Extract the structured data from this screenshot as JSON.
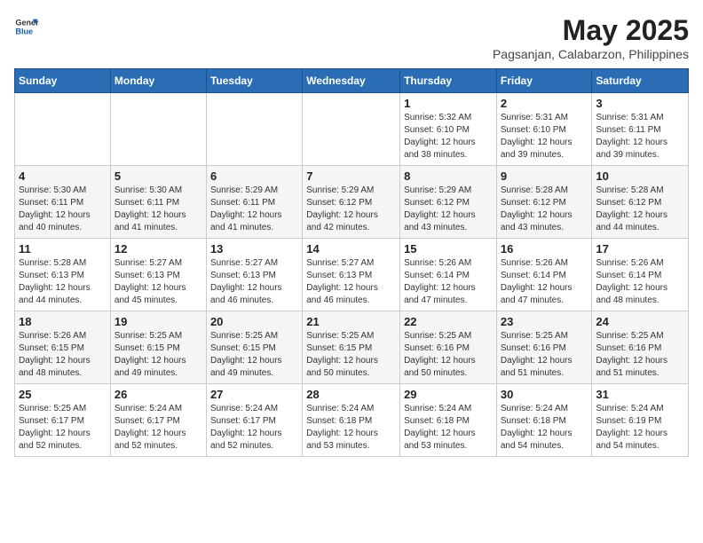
{
  "logo": {
    "general": "General",
    "blue": "Blue"
  },
  "title": "May 2025",
  "subtitle": "Pagsanjan, Calabarzon, Philippines",
  "headers": [
    "Sunday",
    "Monday",
    "Tuesday",
    "Wednesday",
    "Thursday",
    "Friday",
    "Saturday"
  ],
  "weeks": [
    [
      {
        "day": "",
        "info": ""
      },
      {
        "day": "",
        "info": ""
      },
      {
        "day": "",
        "info": ""
      },
      {
        "day": "",
        "info": ""
      },
      {
        "day": "1",
        "info": "Sunrise: 5:32 AM\nSunset: 6:10 PM\nDaylight: 12 hours\nand 38 minutes."
      },
      {
        "day": "2",
        "info": "Sunrise: 5:31 AM\nSunset: 6:10 PM\nDaylight: 12 hours\nand 39 minutes."
      },
      {
        "day": "3",
        "info": "Sunrise: 5:31 AM\nSunset: 6:11 PM\nDaylight: 12 hours\nand 39 minutes."
      }
    ],
    [
      {
        "day": "4",
        "info": "Sunrise: 5:30 AM\nSunset: 6:11 PM\nDaylight: 12 hours\nand 40 minutes."
      },
      {
        "day": "5",
        "info": "Sunrise: 5:30 AM\nSunset: 6:11 PM\nDaylight: 12 hours\nand 41 minutes."
      },
      {
        "day": "6",
        "info": "Sunrise: 5:29 AM\nSunset: 6:11 PM\nDaylight: 12 hours\nand 41 minutes."
      },
      {
        "day": "7",
        "info": "Sunrise: 5:29 AM\nSunset: 6:12 PM\nDaylight: 12 hours\nand 42 minutes."
      },
      {
        "day": "8",
        "info": "Sunrise: 5:29 AM\nSunset: 6:12 PM\nDaylight: 12 hours\nand 43 minutes."
      },
      {
        "day": "9",
        "info": "Sunrise: 5:28 AM\nSunset: 6:12 PM\nDaylight: 12 hours\nand 43 minutes."
      },
      {
        "day": "10",
        "info": "Sunrise: 5:28 AM\nSunset: 6:12 PM\nDaylight: 12 hours\nand 44 minutes."
      }
    ],
    [
      {
        "day": "11",
        "info": "Sunrise: 5:28 AM\nSunset: 6:13 PM\nDaylight: 12 hours\nand 44 minutes."
      },
      {
        "day": "12",
        "info": "Sunrise: 5:27 AM\nSunset: 6:13 PM\nDaylight: 12 hours\nand 45 minutes."
      },
      {
        "day": "13",
        "info": "Sunrise: 5:27 AM\nSunset: 6:13 PM\nDaylight: 12 hours\nand 46 minutes."
      },
      {
        "day": "14",
        "info": "Sunrise: 5:27 AM\nSunset: 6:13 PM\nDaylight: 12 hours\nand 46 minutes."
      },
      {
        "day": "15",
        "info": "Sunrise: 5:26 AM\nSunset: 6:14 PM\nDaylight: 12 hours\nand 47 minutes."
      },
      {
        "day": "16",
        "info": "Sunrise: 5:26 AM\nSunset: 6:14 PM\nDaylight: 12 hours\nand 47 minutes."
      },
      {
        "day": "17",
        "info": "Sunrise: 5:26 AM\nSunset: 6:14 PM\nDaylight: 12 hours\nand 48 minutes."
      }
    ],
    [
      {
        "day": "18",
        "info": "Sunrise: 5:26 AM\nSunset: 6:15 PM\nDaylight: 12 hours\nand 48 minutes."
      },
      {
        "day": "19",
        "info": "Sunrise: 5:25 AM\nSunset: 6:15 PM\nDaylight: 12 hours\nand 49 minutes."
      },
      {
        "day": "20",
        "info": "Sunrise: 5:25 AM\nSunset: 6:15 PM\nDaylight: 12 hours\nand 49 minutes."
      },
      {
        "day": "21",
        "info": "Sunrise: 5:25 AM\nSunset: 6:15 PM\nDaylight: 12 hours\nand 50 minutes."
      },
      {
        "day": "22",
        "info": "Sunrise: 5:25 AM\nSunset: 6:16 PM\nDaylight: 12 hours\nand 50 minutes."
      },
      {
        "day": "23",
        "info": "Sunrise: 5:25 AM\nSunset: 6:16 PM\nDaylight: 12 hours\nand 51 minutes."
      },
      {
        "day": "24",
        "info": "Sunrise: 5:25 AM\nSunset: 6:16 PM\nDaylight: 12 hours\nand 51 minutes."
      }
    ],
    [
      {
        "day": "25",
        "info": "Sunrise: 5:25 AM\nSunset: 6:17 PM\nDaylight: 12 hours\nand 52 minutes."
      },
      {
        "day": "26",
        "info": "Sunrise: 5:24 AM\nSunset: 6:17 PM\nDaylight: 12 hours\nand 52 minutes."
      },
      {
        "day": "27",
        "info": "Sunrise: 5:24 AM\nSunset: 6:17 PM\nDaylight: 12 hours\nand 52 minutes."
      },
      {
        "day": "28",
        "info": "Sunrise: 5:24 AM\nSunset: 6:18 PM\nDaylight: 12 hours\nand 53 minutes."
      },
      {
        "day": "29",
        "info": "Sunrise: 5:24 AM\nSunset: 6:18 PM\nDaylight: 12 hours\nand 53 minutes."
      },
      {
        "day": "30",
        "info": "Sunrise: 5:24 AM\nSunset: 6:18 PM\nDaylight: 12 hours\nand 54 minutes."
      },
      {
        "day": "31",
        "info": "Sunrise: 5:24 AM\nSunset: 6:19 PM\nDaylight: 12 hours\nand 54 minutes."
      }
    ]
  ]
}
